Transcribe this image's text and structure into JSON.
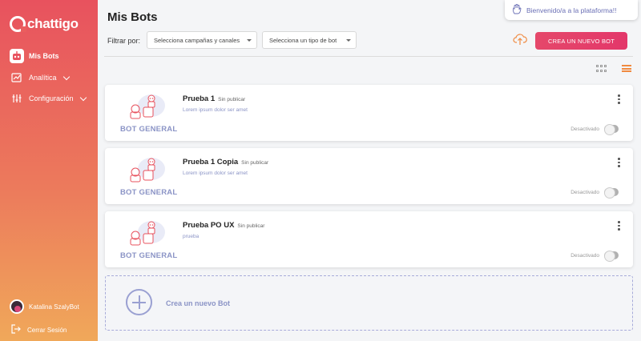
{
  "sidebar": {
    "logo": "chattigo",
    "items": [
      {
        "label": "Mis Bots",
        "icon": "robot-icon"
      },
      {
        "label": "Analítica",
        "icon": "analytics-icon"
      },
      {
        "label": "Configuración",
        "icon": "sliders-icon"
      }
    ],
    "user": {
      "name": "Katalina SzalyBot"
    },
    "logout": "Cerrar Sesión"
  },
  "header": {
    "title": "Mis Bots",
    "toast": "Bienvenido/a a la plataforma!!",
    "filter_label": "Filtrar por:",
    "filter_channels": "Selecciona campañas y canales",
    "filter_type": "Selecciona un tipo de bot",
    "create_button": "CREA UN NUEVO BOT"
  },
  "colors": {
    "accent": "#e3376a",
    "brand_gradient_top": "#e8525e",
    "brand_gradient_bottom": "#f0a85a",
    "muted": "#8b94c6"
  },
  "bots": [
    {
      "type": "BOT GENERAL",
      "name": "Prueba 1",
      "status": "Sin publicar",
      "description": "Lorem ipsum dolor ser amet",
      "toggle_label": "Desactivado"
    },
    {
      "type": "BOT GENERAL",
      "name": "Prueba 1 Copia",
      "status": "Sin publicar",
      "description": "Lorem ipsum dolor ser amet",
      "toggle_label": "Desactivado"
    },
    {
      "type": "BOT GENERAL",
      "name": "Prueba PO UX",
      "status": "Sin publicar",
      "description": "prueba",
      "toggle_label": "Desactivado"
    }
  ],
  "new_bot": {
    "label": "Crea un nuevo Bot"
  }
}
